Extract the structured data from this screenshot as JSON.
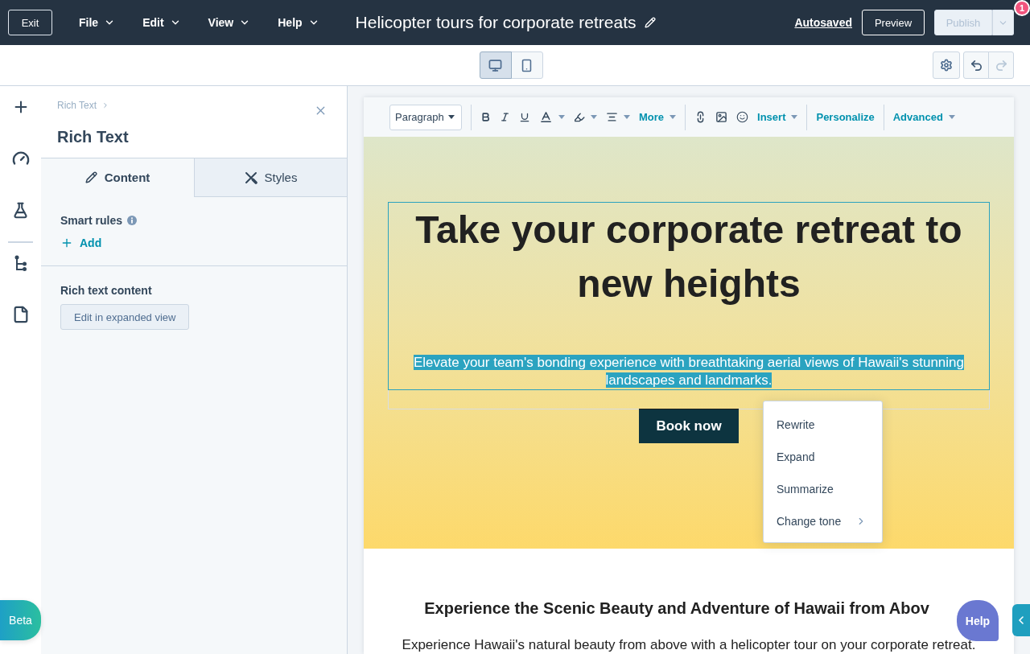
{
  "top_bar": {
    "exit_button": "Exit",
    "menus": [
      {
        "label": "File"
      },
      {
        "label": "Edit"
      },
      {
        "label": "View"
      },
      {
        "label": "Help"
      }
    ],
    "title": "Helicopter tours for corporate retreats",
    "save_status": "Autosaved",
    "preview_button": "Preview",
    "publish_button": {
      "label": "Publish",
      "disabled": true
    },
    "notification_count": "1"
  },
  "view_bar": {
    "devices": [
      {
        "kind": "desktop",
        "selected": true
      },
      {
        "kind": "mobile",
        "selected": false
      }
    ],
    "undo": {
      "disabled": false
    },
    "redo": {
      "disabled": true
    }
  },
  "sidebar": {
    "breadcrumb": "Rich Text",
    "title": "Rich Text",
    "tabs": [
      {
        "kind": "content",
        "label": "Content",
        "selected": true
      },
      {
        "kind": "styles",
        "label": "Styles",
        "selected": false
      }
    ],
    "smart_rules": {
      "label": "Smart rules",
      "add_link": "Add"
    },
    "content_field": {
      "label": "Rich text content",
      "button": "Edit in expanded view"
    }
  },
  "editor_toolbar": {
    "block_format": "Paragraph",
    "more": "More",
    "insert": "Insert",
    "personalize": "Personalize",
    "advanced": "Advanced"
  },
  "hero": {
    "module_selected": true,
    "heading": "Take your corporate retreat to new heights",
    "subheading": {
      "text": "Elevate your team's bonding experience with breathtaking aerial views of Hawaii's stunning landscapes and landmarks.",
      "selected": true
    },
    "button": "Book now"
  },
  "context_menu": {
    "items": [
      {
        "label": "Rewrite",
        "submenu": false
      },
      {
        "label": "Expand",
        "submenu": false
      },
      {
        "label": "Summarize",
        "submenu": false
      },
      {
        "label": "Change tone",
        "submenu": true
      }
    ]
  },
  "section": {
    "heading": "Experience the Scenic Beauty and Adventure of Hawaii from Abov",
    "body": "Experience Hawaii's natural beauty from above with a helicopter tour on your corporate retreat."
  },
  "floating": {
    "beta_button": "Beta",
    "help_button": "Help"
  }
}
